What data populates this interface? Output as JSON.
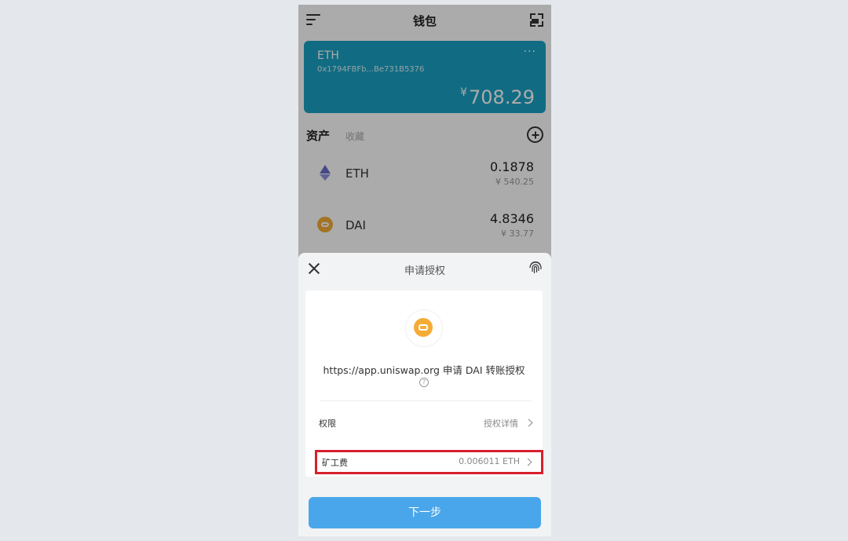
{
  "wallet": {
    "title": "钱包",
    "card": {
      "name": "ETH",
      "address": "0x1794FBFb...Be731B5376",
      "more": "···",
      "currency_symbol": "¥",
      "balance": "708.29",
      "color": "#1aa1c4"
    },
    "assets": {
      "title": "资产",
      "subtitle": "收藏",
      "items": [
        {
          "symbol": "ETH",
          "amount": "0.1878",
          "value": "¥ 540.25",
          "icon": "ethereum-icon"
        },
        {
          "symbol": "DAI",
          "amount": "4.8346",
          "value": "¥ 33.77",
          "icon": "dai-icon"
        }
      ]
    }
  },
  "sheet": {
    "title": "申请授权",
    "request_text": "https://app.uniswap.org 申请 DAI 转账授权",
    "permission_label": "权限",
    "permission_value": "授权详情",
    "fee_label": "矿工费",
    "fee_value": "0.006011 ETH",
    "next_label": "下一步",
    "highlight_color": "#d7202c",
    "button_color": "#4aa6ea"
  }
}
